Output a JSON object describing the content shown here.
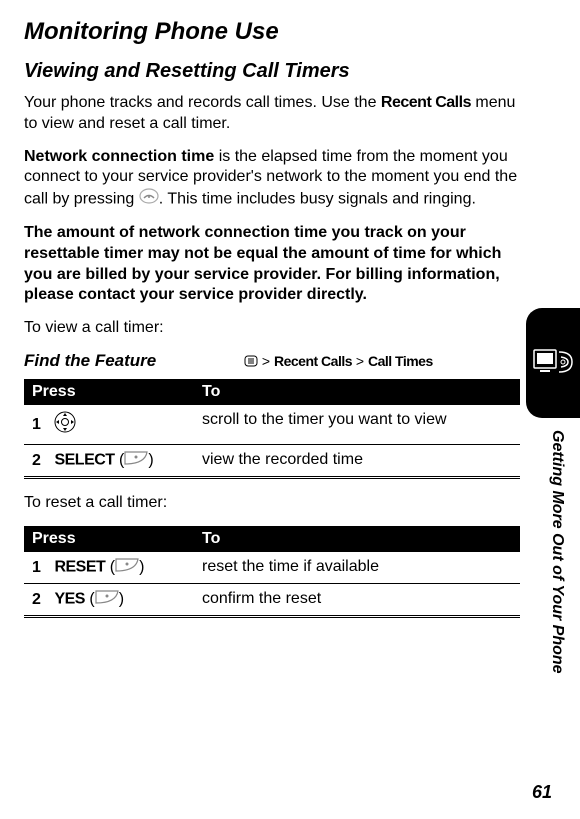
{
  "h1": "Monitoring Phone Use",
  "h2": "Viewing and Resetting Call Timers",
  "para1_a": "Your phone tracks and records call times. Use the ",
  "para1_b": "Recent Calls",
  "para1_c": " menu to view and reset a call timer.",
  "para2_a": "Network connection time",
  "para2_b": " is the elapsed time from the moment you connect to your service provider's network to the moment you end the call by pressing ",
  "para2_c": ". This time includes busy signals and ringing.",
  "para3": "The amount of network connection time you track on your resettable timer may not be equal the amount of time for which you are billed by your service provider. For billing information, please contact your service provider directly.",
  "para4": "To view a call timer:",
  "feature_label": "Find the Feature",
  "feature_path_a": " > ",
  "feature_path_b": "Recent Calls",
  "feature_path_c": " > ",
  "feature_path_d": "Call Times",
  "table1": {
    "head_press": "Press",
    "head_to": "To",
    "rows": [
      {
        "num": "1",
        "press_label": "",
        "to": "scroll to the timer you want to view",
        "icon": "nav"
      },
      {
        "num": "2",
        "press_label": "SELECT",
        "to": "view the recorded time",
        "icon": "softkey"
      }
    ]
  },
  "para5": "To reset a call timer:",
  "table2": {
    "head_press": "Press",
    "head_to": "To",
    "rows": [
      {
        "num": "1",
        "press_label": "RESET",
        "to": "reset the time if available",
        "icon": "softkey"
      },
      {
        "num": "2",
        "press_label": "YES",
        "to": "confirm the reset",
        "icon": "softkey"
      }
    ]
  },
  "side_label": "Getting More Out of Your Phone",
  "page_num": "61"
}
